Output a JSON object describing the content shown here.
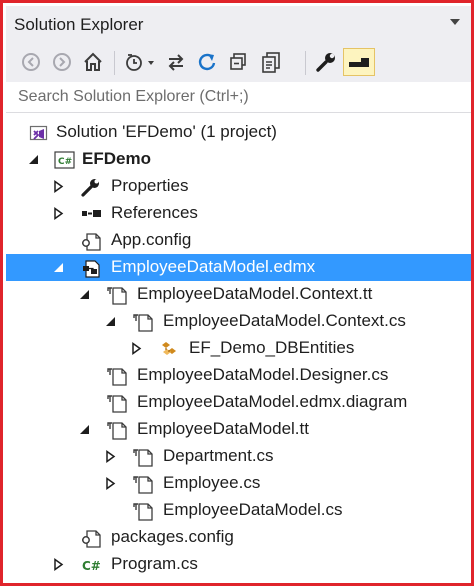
{
  "panel": {
    "title": "Solution Explorer"
  },
  "search": {
    "placeholder": "Search Solution Explorer (Ctrl+;)"
  },
  "toolbar": {
    "buttons": [
      "back-icon",
      "forward-icon",
      "home-icon",
      "pending-changes-filter-icon",
      "sync-with-active-document-icon",
      "refresh-icon",
      "collapse-all-icon",
      "show-all-files-icon",
      "properties-icon",
      "preview-selected-items-icon"
    ]
  },
  "tree": {
    "solution": "Solution 'EFDemo' (1 project)",
    "project": "EFDemo",
    "properties": "Properties",
    "references": "References",
    "app_config": "App.config",
    "edmx": "EmployeeDataModel.edmx",
    "context_tt": "EmployeeDataModel.Context.tt",
    "context_cs": "EmployeeDataModel.Context.cs",
    "db_entities": "EF_Demo_DBEntities",
    "designer_cs": "EmployeeDataModel.Designer.cs",
    "edmx_diagram": "EmployeeDataModel.edmx.diagram",
    "model_tt": "EmployeeDataModel.tt",
    "department_cs": "Department.cs",
    "employee_cs": "Employee.cs",
    "model_cs": "EmployeeDataModel.cs",
    "packages_config": "packages.config",
    "program_cs": "Program.cs",
    "selected": "EmployeeDataModel.edmx"
  },
  "colors": {
    "accent": "#e0242b",
    "selection": "#3399ff",
    "toolbar_bg": "#eeeef2"
  }
}
